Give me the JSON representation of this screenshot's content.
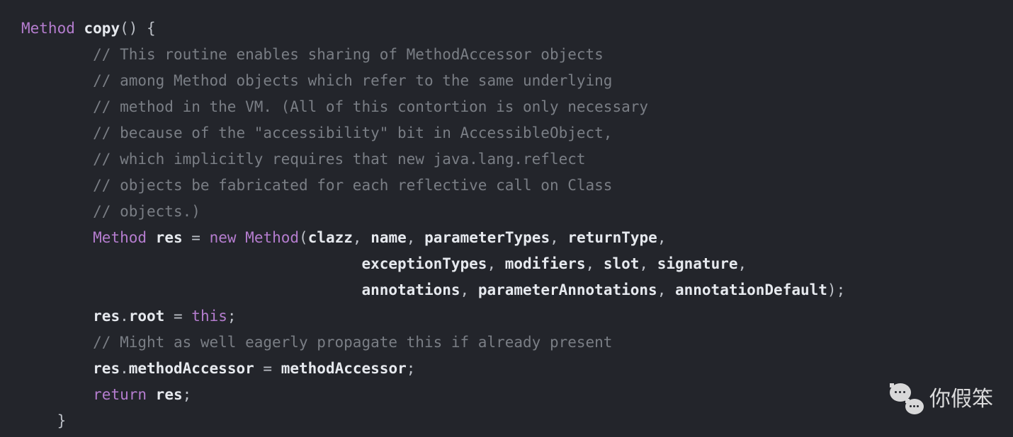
{
  "code": {
    "lines": [
      {
        "indent": 0,
        "segments": [
          {
            "cls": "keyword-type",
            "t": "Method"
          },
          {
            "cls": "normal",
            "t": " "
          },
          {
            "cls": "method-name",
            "t": "copy"
          },
          {
            "cls": "punct",
            "t": "()"
          },
          {
            "cls": "normal",
            "t": " "
          },
          {
            "cls": "punct",
            "t": "{"
          }
        ]
      },
      {
        "indent": 2,
        "segments": [
          {
            "cls": "comment",
            "t": "// This routine enables sharing of MethodAccessor objects"
          }
        ]
      },
      {
        "indent": 2,
        "segments": [
          {
            "cls": "comment",
            "t": "// among Method objects which refer to the same underlying"
          }
        ]
      },
      {
        "indent": 2,
        "segments": [
          {
            "cls": "comment",
            "t": "// method in the VM. (All of this contortion is only necessary"
          }
        ]
      },
      {
        "indent": 2,
        "segments": [
          {
            "cls": "comment",
            "t": "// because of the \"accessibility\" bit in AccessibleObject,"
          }
        ]
      },
      {
        "indent": 2,
        "segments": [
          {
            "cls": "comment",
            "t": "// which implicitly requires that new java.lang.reflect"
          }
        ]
      },
      {
        "indent": 2,
        "segments": [
          {
            "cls": "comment",
            "t": "// objects be fabricated for each reflective call on Class"
          }
        ]
      },
      {
        "indent": 2,
        "segments": [
          {
            "cls": "comment",
            "t": "// objects.)"
          }
        ]
      },
      {
        "indent": 2,
        "segments": [
          {
            "cls": "keyword-type",
            "t": "Method"
          },
          {
            "cls": "normal",
            "t": " "
          },
          {
            "cls": "ident",
            "t": "res"
          },
          {
            "cls": "normal",
            "t": " "
          },
          {
            "cls": "punct",
            "t": "="
          },
          {
            "cls": "normal",
            "t": " "
          },
          {
            "cls": "keyword",
            "t": "new"
          },
          {
            "cls": "normal",
            "t": " "
          },
          {
            "cls": "keyword-type",
            "t": "Method"
          },
          {
            "cls": "punct",
            "t": "("
          },
          {
            "cls": "ident",
            "t": "clazz"
          },
          {
            "cls": "punct",
            "t": ", "
          },
          {
            "cls": "ident",
            "t": "name"
          },
          {
            "cls": "punct",
            "t": ", "
          },
          {
            "cls": "ident",
            "t": "parameterTypes"
          },
          {
            "cls": "punct",
            "t": ", "
          },
          {
            "cls": "ident",
            "t": "returnType"
          },
          {
            "cls": "punct",
            "t": ","
          }
        ]
      },
      {
        "indent": 8,
        "segments": [
          {
            "cls": "normal",
            "t": "      "
          },
          {
            "cls": "ident",
            "t": "exceptionTypes"
          },
          {
            "cls": "punct",
            "t": ", "
          },
          {
            "cls": "ident",
            "t": "modifiers"
          },
          {
            "cls": "punct",
            "t": ", "
          },
          {
            "cls": "ident",
            "t": "slot"
          },
          {
            "cls": "punct",
            "t": ", "
          },
          {
            "cls": "ident",
            "t": "signature"
          },
          {
            "cls": "punct",
            "t": ","
          }
        ]
      },
      {
        "indent": 8,
        "segments": [
          {
            "cls": "normal",
            "t": "      "
          },
          {
            "cls": "ident",
            "t": "annotations"
          },
          {
            "cls": "punct",
            "t": ", "
          },
          {
            "cls": "ident",
            "t": "parameterAnnotations"
          },
          {
            "cls": "punct",
            "t": ", "
          },
          {
            "cls": "ident",
            "t": "annotationDefault"
          },
          {
            "cls": "punct",
            "t": ");"
          }
        ]
      },
      {
        "indent": 2,
        "segments": [
          {
            "cls": "ident",
            "t": "res"
          },
          {
            "cls": "punct",
            "t": "."
          },
          {
            "cls": "ident",
            "t": "root"
          },
          {
            "cls": "normal",
            "t": " "
          },
          {
            "cls": "punct",
            "t": "="
          },
          {
            "cls": "normal",
            "t": " "
          },
          {
            "cls": "this",
            "t": "this"
          },
          {
            "cls": "punct",
            "t": ";"
          }
        ]
      },
      {
        "indent": 2,
        "segments": [
          {
            "cls": "comment",
            "t": "// Might as well eagerly propagate this if already present"
          }
        ]
      },
      {
        "indent": 2,
        "segments": [
          {
            "cls": "ident",
            "t": "res"
          },
          {
            "cls": "punct",
            "t": "."
          },
          {
            "cls": "ident",
            "t": "methodAccessor"
          },
          {
            "cls": "normal",
            "t": " "
          },
          {
            "cls": "punct",
            "t": "="
          },
          {
            "cls": "normal",
            "t": " "
          },
          {
            "cls": "ident",
            "t": "methodAccessor"
          },
          {
            "cls": "punct",
            "t": ";"
          }
        ]
      },
      {
        "indent": 2,
        "segments": [
          {
            "cls": "keyword",
            "t": "return"
          },
          {
            "cls": "normal",
            "t": " "
          },
          {
            "cls": "ident",
            "t": "res"
          },
          {
            "cls": "punct",
            "t": ";"
          }
        ]
      },
      {
        "indent": 1,
        "segments": [
          {
            "cls": "punct",
            "t": "}"
          }
        ]
      }
    ]
  },
  "watermark": {
    "text": "你假笨"
  },
  "indent_unit": "    "
}
